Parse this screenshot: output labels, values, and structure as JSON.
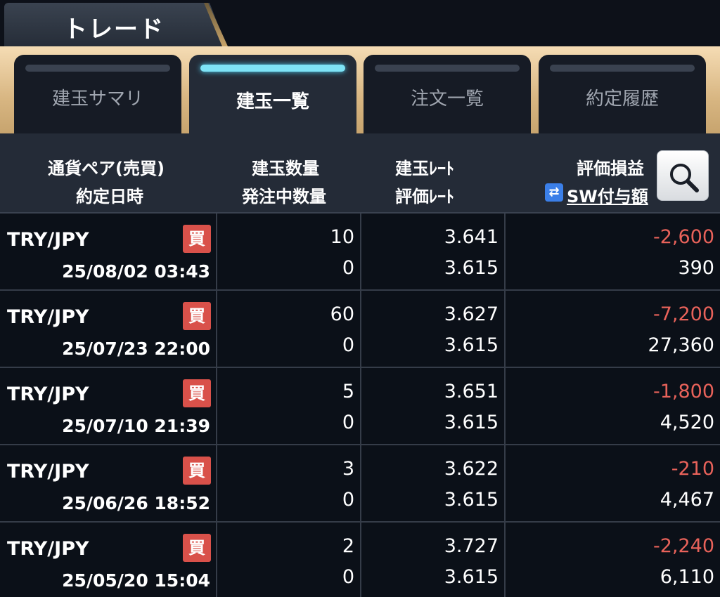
{
  "header": {
    "title": "トレード"
  },
  "tabs": [
    {
      "label": "建玉サマリ",
      "active": false
    },
    {
      "label": "建玉一覧",
      "active": true
    },
    {
      "label": "注文一覧",
      "active": false
    },
    {
      "label": "約定履歴",
      "active": false
    }
  ],
  "columns": {
    "c1_line1": "通貨ペア(売買)",
    "c1_line2": "約定日時",
    "c2_line1": "建玉数量",
    "c2_line2": "発注中数量",
    "c3_line1": "建玉ﾚｰﾄ",
    "c3_line2": "評価ﾚｰﾄ",
    "c4_line1": "評価損益",
    "c4_line2": "SW付与額",
    "swap_icon": "⇄",
    "search_icon": "search-icon"
  },
  "colors": {
    "accent": "#7ee3f6",
    "negative": "#e8625a",
    "buy_badge": "#d9514a"
  },
  "rows": [
    {
      "pair": "TRY/JPY",
      "side": "買",
      "datetime": "25/08/02 03:43",
      "qty": "10",
      "pending": "0",
      "open_rate": "3.641",
      "eval_rate": "3.615",
      "pl": "-2,600",
      "swap": "390"
    },
    {
      "pair": "TRY/JPY",
      "side": "買",
      "datetime": "25/07/23 22:00",
      "qty": "60",
      "pending": "0",
      "open_rate": "3.627",
      "eval_rate": "3.615",
      "pl": "-7,200",
      "swap": "27,360"
    },
    {
      "pair": "TRY/JPY",
      "side": "買",
      "datetime": "25/07/10 21:39",
      "qty": "5",
      "pending": "0",
      "open_rate": "3.651",
      "eval_rate": "3.615",
      "pl": "-1,800",
      "swap": "4,520"
    },
    {
      "pair": "TRY/JPY",
      "side": "買",
      "datetime": "25/06/26 18:52",
      "qty": "3",
      "pending": "0",
      "open_rate": "3.622",
      "eval_rate": "3.615",
      "pl": "-210",
      "swap": "4,467"
    },
    {
      "pair": "TRY/JPY",
      "side": "買",
      "datetime": "25/05/20 15:04",
      "qty": "2",
      "pending": "0",
      "open_rate": "3.727",
      "eval_rate": "3.615",
      "pl": "-2,240",
      "swap": "6,110"
    }
  ]
}
